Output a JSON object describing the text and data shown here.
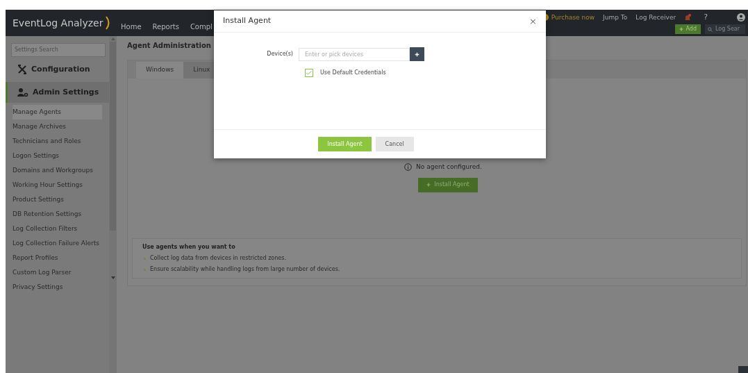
{
  "header": {
    "logo": "EventLog Analyzer",
    "nav": [
      {
        "label": "Home"
      },
      {
        "label": "Reports"
      },
      {
        "label": "Compl"
      }
    ],
    "links": [
      {
        "label": "Purchase now",
        "kind": "promo"
      },
      {
        "label": "Jump To",
        "kind": "plain"
      },
      {
        "label": "Log Receiver",
        "kind": "plain"
      }
    ],
    "help": "?",
    "add_button": "Add",
    "search_placeholder": "Log Sear"
  },
  "sidebar": {
    "search_placeholder": "Settings Search",
    "sections": [
      {
        "label": "Configuration",
        "kind": "tools",
        "selected": false
      },
      {
        "label": "Admin Settings",
        "kind": "admin",
        "selected": true
      }
    ],
    "items": [
      {
        "label": "Manage Agents",
        "selected": true
      },
      {
        "label": "Manage Archives",
        "selected": false
      },
      {
        "label": "Technicians and Roles",
        "selected": false
      },
      {
        "label": "Logon Settings",
        "selected": false
      },
      {
        "label": "Domains and Workgroups",
        "selected": false
      },
      {
        "label": "Working Hour Settings",
        "selected": false
      },
      {
        "label": "Product Settings",
        "selected": false
      },
      {
        "label": "DB Retention Settings",
        "selected": false
      },
      {
        "label": "Log Collection Filters",
        "selected": false
      },
      {
        "label": "Log Collection Failure Alerts",
        "selected": false
      },
      {
        "label": "Report Profiles",
        "selected": false
      },
      {
        "label": "Custom Log Parser",
        "selected": false
      },
      {
        "label": "Privacy Settings",
        "selected": false
      }
    ]
  },
  "main": {
    "title": "Agent Administration",
    "tabs": [
      {
        "label": "Windows",
        "selected": true
      },
      {
        "label": "Linux",
        "selected": false
      }
    ],
    "empty_message": "No agent configured.",
    "install_button": "Install Agent",
    "info": {
      "heading": "Use agents when you want to",
      "bullets": [
        "Collect log data from devices in restricted zones.",
        "Ensure scalability while handling logs from large number of devices."
      ]
    }
  },
  "dialog": {
    "title": "Install Agent",
    "close": "×",
    "device_label": "Device(s)",
    "device_placeholder": "Enter or pick devices",
    "checkbox": {
      "label": "Use Default Credentials",
      "checked": true
    },
    "buttons": [
      {
        "label": "Install Agent",
        "kind": "primary"
      },
      {
        "label": "Cancel",
        "kind": "secondary"
      }
    ]
  }
}
